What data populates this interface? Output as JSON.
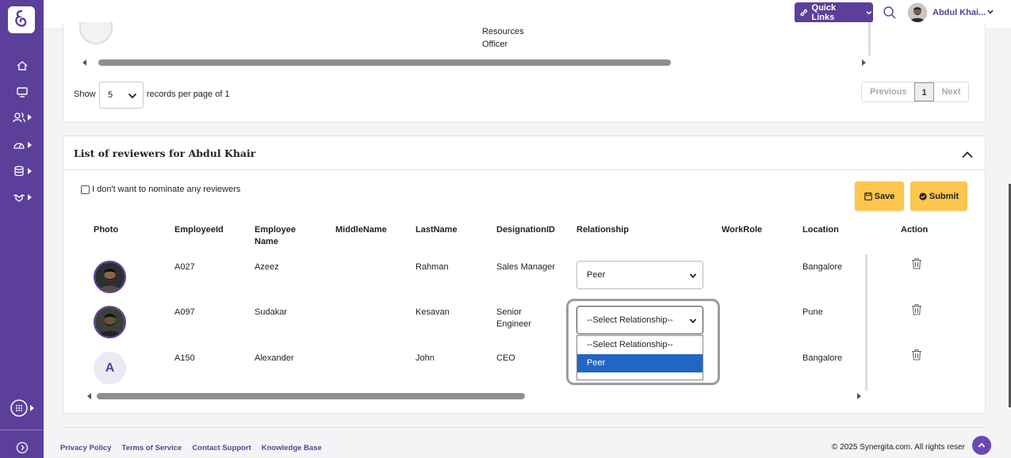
{
  "header": {
    "quick_links_label": "Quick Links",
    "user_name": "Abdul Khai..."
  },
  "sidebar": {
    "icons": [
      "home-icon",
      "monitor-icon",
      "people-icon",
      "gauge-icon",
      "database-icon",
      "handshake-icon",
      "apps-grid-icon",
      "collapse-sidebar-icon"
    ]
  },
  "records_panel": {
    "visible_role_line1": "Resources",
    "visible_role_line2": "Officer",
    "show_label": "Show",
    "page_size_value": "5",
    "records_label": "records per page of 1",
    "pagination": {
      "previous_label": "Previous",
      "current_page": "1",
      "next_label": "Next"
    }
  },
  "reviewers_panel": {
    "title": "List of reviewers for Abdul Khair",
    "nominate_checkbox_label": "I don't want to nominate any reviewers",
    "save_label": "Save",
    "submit_label": "Submit",
    "columns": {
      "photo": "Photo",
      "employee_id": "EmployeeId",
      "employee_name_line1": "Employee",
      "employee_name_line2": "Name",
      "middle_name": "MiddleName",
      "last_name": "LastName",
      "designation": "DesignationID",
      "relationship": "Relationship",
      "work_role": "WorkRole",
      "location": "Location",
      "action": "Action"
    },
    "rows": [
      {
        "employee_id": "A027",
        "name": "Azeez",
        "middle_name": "",
        "last_name": "Rahman",
        "designation_line1": "Sales Manager",
        "designation_line2": "",
        "relationship": "Peer",
        "work_role": "",
        "location": "Bangalore",
        "avatar_initial": ""
      },
      {
        "employee_id": "A097",
        "name": "Sudakar",
        "middle_name": "",
        "last_name": "Kesavan",
        "designation_line1": "Senior",
        "designation_line2": "Engineer",
        "relationship": "--Select Relationship--",
        "work_role": "",
        "location": "Pune",
        "avatar_initial": ""
      },
      {
        "employee_id": "A150",
        "name": "Alexander",
        "middle_name": "",
        "last_name": "John",
        "designation_line1": "CEO",
        "designation_line2": "",
        "relationship": "",
        "work_role": "",
        "location": "Bangalore",
        "avatar_initial": "A"
      }
    ],
    "relationship_dropdown": {
      "options": [
        "--Select Relationship--",
        "Peer"
      ],
      "highlighted_option": "Peer"
    }
  },
  "footer": {
    "links": [
      "Privacy Policy",
      "Terms of Service",
      "Contact Support",
      "Knowledge Base"
    ],
    "copyright": "© 2025 Synergita.com. All rights reser"
  },
  "colors": {
    "brand_purple": "#5b3f9a",
    "button_yellow": "#fcc64f",
    "dropdown_highlight": "#2166c7"
  }
}
